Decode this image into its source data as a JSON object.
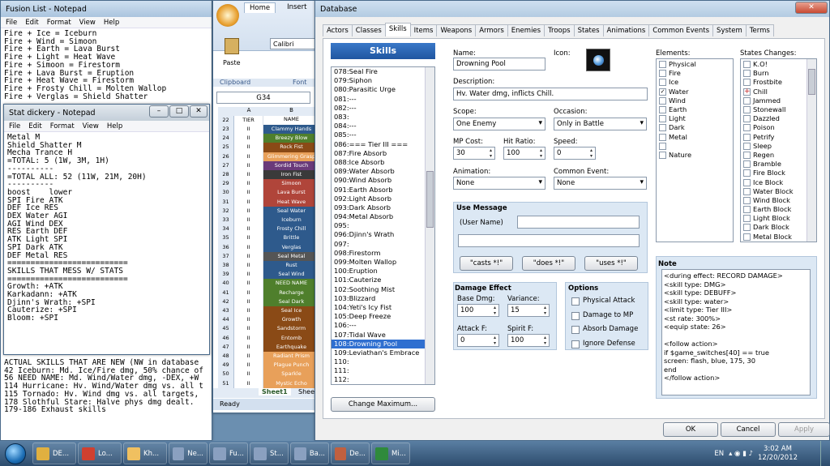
{
  "notepad1": {
    "title": "Fusion List - Notepad",
    "menu": [
      "File",
      "Edit",
      "Format",
      "View",
      "Help"
    ],
    "lines": [
      "Fire + Ice = Iceburn",
      "Fire + Wind = Simoon",
      "Fire + Earth = Lava Burst",
      "Fire + Light = Heat Wave",
      "Fire + Simoon = Firestorm",
      "Fire + Lava Burst = Eruption",
      "Fire + Heat Wave = Firestorm",
      "Fire + Frosty Chill = Molten Wallop",
      "Fire + Verglas = Shield Shatter"
    ],
    "bottom_lines": [
      "ACTUAL SKILLS THAT ARE NEW (NW in database",
      "",
      "42 Iceburn: Md. Ice/Fire dmg, 50% chance of",
      "56 NEED NAME: Md. Wind/Water dmg, -DEX, +W",
      "114 Hurricane: Hv. Wind/Water dmg vs. all t",
      "115 Tornado: Hv. Wind dmg vs. all targets,",
      "178 Slothful Stare: Halve phys dmg dealt.",
      "179-186 Exhaust skills"
    ]
  },
  "notepad2": {
    "title": "Stat dickery - Notepad",
    "menu": [
      "File",
      "Edit",
      "Format",
      "View",
      "Help"
    ],
    "lines": [
      "Metal M",
      "Shield Shatter M",
      "Mecha Trance H",
      "=TOTAL: 5 (1W, 3M, 1H)",
      "----------",
      "=TOTAL ALL: 52 (11W, 21M, 20H)",
      "----------",
      "",
      "boost    lower",
      "SPI Fire ATK",
      "DEF Ice RES",
      "DEX Water AGI",
      "AGI Wind DEX",
      "RES Earth DEF",
      "ATK Light SPI",
      "SPI Dark ATK",
      "DEF Metal RES",
      "==========================",
      "SKILLS THAT MESS W/ STATS",
      "==========================",
      "Growth: +ATK",
      "Karkadann: +ATK",
      "",
      "Djinn's Wrath: +SPI",
      "Cauterize: +SPI",
      "Bloom: +SPI"
    ]
  },
  "excel": {
    "tabs": [
      "Home",
      "Insert"
    ],
    "font": "Calibri",
    "paste": "Paste",
    "clipboard": "Clipboard",
    "font_group": "Font",
    "namebox": "G34",
    "col_a": "A",
    "col_b": "B",
    "hdr_tier": "TIER",
    "hdr_name": "NAME",
    "rows": [
      {
        "n": "23",
        "t": "II",
        "name": "Clammy Hands",
        "c": "#2e5a8c"
      },
      {
        "n": "24",
        "t": "II",
        "name": "Breezy Blow",
        "c": "#4f7f2c"
      },
      {
        "n": "25",
        "t": "II",
        "name": "Rock Fist",
        "c": "#8a4a16"
      },
      {
        "n": "26",
        "t": "II",
        "name": "Glimmering Grasp",
        "c": "#e8a05a"
      },
      {
        "n": "27",
        "t": "II",
        "name": "Sordid Touch",
        "c": "#6a3a7a"
      },
      {
        "n": "28",
        "t": "II",
        "name": "Iron Fist",
        "c": "#3a3a3a"
      },
      {
        "n": "29",
        "t": "II",
        "name": "Simoon",
        "c": "#b0453a"
      },
      {
        "n": "30",
        "t": "II",
        "name": "Lava Burst",
        "c": "#b0453a"
      },
      {
        "n": "31",
        "t": "II",
        "name": "Heat Wave",
        "c": "#b0453a"
      },
      {
        "n": "32",
        "t": "II",
        "name": "Seal Water",
        "c": "#2e5a8c"
      },
      {
        "n": "33",
        "t": "II",
        "name": "Iceburn",
        "c": "#2e5a8c"
      },
      {
        "n": "34",
        "t": "II",
        "name": "Frosty Chill",
        "c": "#2e5a8c"
      },
      {
        "n": "35",
        "t": "II",
        "name": "Brittle",
        "c": "#2e5a8c"
      },
      {
        "n": "36",
        "t": "II",
        "name": "Verglas",
        "c": "#2e5a8c"
      },
      {
        "n": "37",
        "t": "II",
        "name": "Seal Metal",
        "c": "#555555"
      },
      {
        "n": "38",
        "t": "II",
        "name": "Rust",
        "c": "#2e5a8c"
      },
      {
        "n": "39",
        "t": "II",
        "name": "Seal Wind",
        "c": "#2e5a8c"
      },
      {
        "n": "40",
        "t": "II",
        "name": "NEED NAME",
        "c": "#4f7f2c"
      },
      {
        "n": "41",
        "t": "II",
        "name": "Recharge",
        "c": "#4f7f2c"
      },
      {
        "n": "42",
        "t": "II",
        "name": "Seal Dark",
        "c": "#4f7f2c"
      },
      {
        "n": "43",
        "t": "II",
        "name": "Seal Ice",
        "c": "#8a4a16"
      },
      {
        "n": "44",
        "t": "II",
        "name": "Growth",
        "c": "#8a4a16"
      },
      {
        "n": "45",
        "t": "II",
        "name": "Sandstorm",
        "c": "#8a4a16"
      },
      {
        "n": "46",
        "t": "II",
        "name": "Entomb",
        "c": "#8a4a16"
      },
      {
        "n": "47",
        "t": "II",
        "name": "Earthquake",
        "c": "#8a4a16"
      },
      {
        "n": "48",
        "t": "II",
        "name": "Radiant Prism",
        "c": "#e8a05a"
      },
      {
        "n": "49",
        "t": "II",
        "name": "Plague Punch",
        "c": "#e8a05a"
      },
      {
        "n": "50",
        "t": "II",
        "name": "Sparkle",
        "c": "#e8a05a"
      },
      {
        "n": "51",
        "t": "II",
        "name": "Mystic Echo",
        "c": "#e8a05a"
      }
    ],
    "sheet": "Sheet1",
    "sheet2": "Shee",
    "status": "Ready"
  },
  "db": {
    "title": "Database",
    "tabs": [
      "Actors",
      "Classes",
      "Skills",
      "Items",
      "Weapons",
      "Armors",
      "Enemies",
      "Troops",
      "States",
      "Animations",
      "Common Events",
      "System",
      "Terms"
    ],
    "list_header": "Skills",
    "list": [
      "078:Seal Fire",
      "079:Siphon",
      "080:Parasitic Urge",
      "081:---",
      "082:---",
      "083:",
      "084:---",
      "085:---",
      "086:=== Tier III ===",
      "087:Fire Absorb",
      "088:Ice Absorb",
      "089:Water Absorb",
      "090:Wind Absorb",
      "091:Earth Absorb",
      "092:Light Absorb",
      "093:Dark Absorb",
      "094:Metal Absorb",
      "095:",
      "096:Djinn's Wrath",
      "097:",
      "098:Firestorm",
      "099:Molten Wallop",
      "100:Eruption",
      "101:Cauterize",
      "102:Soothing Mist",
      "103:Blizzard",
      "104:Yeti's Icy Fist",
      "105:Deep Freeze",
      "106:---",
      "107:Tidal Wave",
      "108:Drowning Pool",
      "109:Leviathan's Embrace",
      "110:",
      "111:",
      "112:"
    ],
    "selected": "108:Drowning Pool",
    "change_max": "Change Maximum...",
    "name_lbl": "Name:",
    "name": "Drowning Pool",
    "icon_lbl": "Icon:",
    "desc_lbl": "Description:",
    "desc": "Hv. Water dmg, inflicts Chill.",
    "scope_lbl": "Scope:",
    "scope": "One Enemy",
    "occ_lbl": "Occasion:",
    "occ": "Only in Battle",
    "mp_lbl": "MP Cost:",
    "mp": "30",
    "hit_lbl": "Hit Ratio:",
    "hit": "100",
    "spd_lbl": "Speed:",
    "spd": "0",
    "anim_lbl": "Animation:",
    "anim": "None",
    "ce_lbl": "Common Event:",
    "ce": "None",
    "use_msg": "Use Message",
    "user_name": "(User Name)",
    "casts": "\"casts *!\"",
    "does": "\"does *!\"",
    "uses": "\"uses *!\"",
    "dmg_title": "Damage Effect",
    "base_lbl": "Base Dmg:",
    "base": "100",
    "var_lbl": "Variance:",
    "var": "15",
    "atk_lbl": "Attack F:",
    "atk": "0",
    "spi_lbl": "Spirit F:",
    "spi": "100",
    "opt_title": "Options",
    "opts": [
      "Physical Attack",
      "Damage to MP",
      "Absorb Damage",
      "Ignore Defense"
    ],
    "elem_lbl": "Elements:",
    "elements": [
      {
        "n": "Physical",
        "c": false
      },
      {
        "n": "Fire",
        "c": false
      },
      {
        "n": "Ice",
        "c": false
      },
      {
        "n": "Water",
        "c": true
      },
      {
        "n": "Wind",
        "c": false
      },
      {
        "n": "Earth",
        "c": false
      },
      {
        "n": "Light",
        "c": false
      },
      {
        "n": "Dark",
        "c": false
      },
      {
        "n": "Metal",
        "c": false
      },
      {
        "n": "",
        "c": false
      },
      {
        "n": "Nature",
        "c": false
      }
    ],
    "states_lbl": "States Changes:",
    "states": [
      {
        "n": "K.O!",
        "m": ""
      },
      {
        "n": "Burn",
        "m": ""
      },
      {
        "n": "Frostbite",
        "m": ""
      },
      {
        "n": "Chill",
        "m": "+"
      },
      {
        "n": "Jammed",
        "m": ""
      },
      {
        "n": "Stonewall",
        "m": ""
      },
      {
        "n": "Dazzled",
        "m": ""
      },
      {
        "n": "Poison",
        "m": ""
      },
      {
        "n": "Petrify",
        "m": ""
      },
      {
        "n": "Sleep",
        "m": ""
      },
      {
        "n": "Regen",
        "m": ""
      },
      {
        "n": "Bramble",
        "m": ""
      },
      {
        "n": "Fire Block",
        "m": ""
      },
      {
        "n": "Ice Block",
        "m": ""
      },
      {
        "n": "Water Block",
        "m": ""
      },
      {
        "n": "Wind Block",
        "m": ""
      },
      {
        "n": "Earth Block",
        "m": ""
      },
      {
        "n": "Light Block",
        "m": ""
      },
      {
        "n": "Dark Block",
        "m": ""
      },
      {
        "n": "Metal Block",
        "m": ""
      }
    ],
    "note_lbl": "Note",
    "note": "<during effect: RECORD DAMAGE>\n<skill type: DMG>\n<skill type: DEBUFF>\n<skill type: water>\n<limit type: Tier III>\n<st rate: 300%>\n<equip state: 26>\n\n<follow action>\nif $game_switches[40] == true\nscreen: flash, blue, 175, 30\nend\n</follow action>",
    "ok": "OK",
    "cancel": "Cancel",
    "apply": "Apply"
  },
  "taskbar": {
    "items": [
      "DE...",
      "Lo...",
      "Kh...",
      "Ne...",
      "Fu...",
      "St...",
      "Ba...",
      "De...",
      "Mi..."
    ],
    "lang": "EN",
    "time": "3:02 AM",
    "date": "12/20/2012",
    "colors": [
      "#e0b040",
      "#d04030",
      "#f0c060",
      "#8aa0c0",
      "#8aa0c0",
      "#8aa0c0",
      "#8aa0c0",
      "#c06040",
      "#2f8a3c"
    ]
  }
}
